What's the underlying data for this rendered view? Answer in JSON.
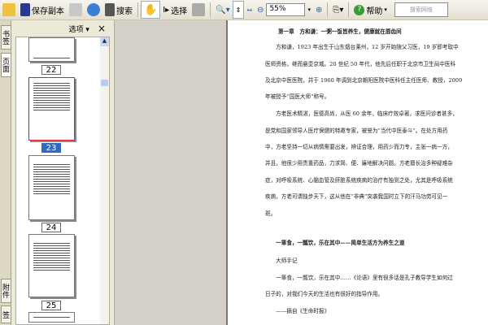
{
  "toolbar": {
    "save_copy": "保存副本",
    "search": "搜索",
    "select": "选择",
    "zoom": "55%",
    "help": "帮助",
    "search_placeholder": "搜索网络"
  },
  "sidetabs": [
    "书签",
    "页面",
    "附件",
    "签名"
  ],
  "panel": {
    "options": "选项",
    "close": "×",
    "pages": [
      "22",
      "23",
      "24",
      "25"
    ],
    "selected_page": "23"
  },
  "document": {
    "title": "第一章　方和谦：一粥一饭皆养生，健康就在唇齿间",
    "lines": [
      "　　方和谦，1923 年出生于山东烟台莱州，12 岁开始随父习医，19 岁即考取中",
      "医师资格，继而悬壶京城。20 世纪 50 年代，他先后任职于北京市卫生局中医科",
      "及北京中医医院，并于 1960 年调到北京朝阳医院中医科任主任医师、教授，2009",
      "年被授予“国医大师”称号。",
      "　　方老医术精湛，医德高尚，从医 60 余年，临床疗效卓著，求医问诊者甚多，",
      "是党和国家领导人医疗保健的特邀专家，被誉为“当代中医泰斗”。在处方用药",
      "中，方老坚持一切从病情需要出发，辨证合理，用药少而力专，主张一病一方，",
      "并且，他很少用贵重药品，力求简、便、廉地解决问题。方老擅长治多种疑难杂",
      "症，对呼吸系统、心脑血管及肝脏系统疾病的治疗有独到之处，尤其是呼吸系统",
      "疾病，方老可谓独步天下，这从他在“非典”突袭我国时立下的汗马功劳可见一",
      "斑。"
    ],
    "subheading": "　　一箪食，一瓢饮，乐在其中——简单生活方为养生之道",
    "lines2": [
      "　　大师手记",
      "　　一箪食，一瓢饮，乐在其中……《论语》里有很多话是孔子教导学生如何过",
      "日子的，对我们今天的生活也有很好的指导作用。",
      "　　——摘自《生命时报》"
    ]
  }
}
